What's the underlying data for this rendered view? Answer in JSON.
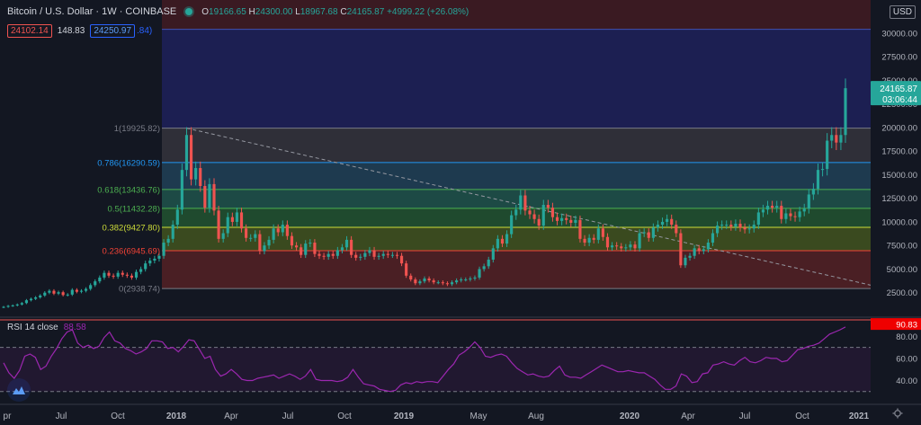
{
  "header": {
    "title": "Bitcoin / U.S. Dollar · 1W · COINBASE",
    "ohlc": {
      "o": "19166.65",
      "h": "24300.00",
      "l": "18967.68",
      "c": "24165.87",
      "chg": "+4999.22 (+26.08%)"
    }
  },
  "bid_ask": {
    "bid": "24102.14",
    "spread": "148.83",
    "ask": "24250.97",
    "ask_extra": ".84)"
  },
  "currency": "USD",
  "rsi": {
    "label": "RSI 14 close",
    "value": "88.58",
    "last_badge": "90.83",
    "y_ticks": [
      "80.00",
      "60.00",
      "40.00"
    ],
    "bands": [
      70,
      30
    ]
  },
  "price_axis": {
    "last_price": "24165.87",
    "countdown": "03:06:44"
  },
  "colors": {
    "up": "#26a69a",
    "down": "#ef5350",
    "rsi": "#9c27b0",
    "background": "#131722",
    "text": "#d1d4dc",
    "ask": "#2962ff"
  },
  "icons": {
    "logo": "tradingview-icon",
    "settings": "gear-icon"
  },
  "chart_data": {
    "type": "candlestick",
    "title": "Bitcoin / U.S. Dollar",
    "timeframe": "1W",
    "exchange": "COINBASE",
    "x_tick_labels": [
      "pr",
      "Jul",
      "Oct",
      "2018",
      "Apr",
      "Jul",
      "Oct",
      "2019",
      "May",
      "Aug",
      "2020",
      "Apr",
      "Jul",
      "Oct",
      "2021"
    ],
    "y_ticks": [
      "2500.00",
      "5000.00",
      "7500.00",
      "10000.00",
      "12500.00",
      "15000.00",
      "17500.00",
      "20000.00",
      "22500.00",
      "25000.00",
      "27500.00",
      "30000.00"
    ],
    "ylim": [
      0,
      33500
    ],
    "fib_levels": [
      {
        "label": "1(19925.82)",
        "value": 19925.82,
        "color": "#787b86"
      },
      {
        "label": "0.786(16290.59)",
        "value": 16290.59,
        "color": "#2196f3"
      },
      {
        "label": "0.618(13436.76)",
        "value": 13436.76,
        "color": "#4caf50"
      },
      {
        "label": "0.5(11432.28)",
        "value": 11432.28,
        "color": "#4caf50"
      },
      {
        "label": "0.382(9427.80)",
        "value": 9427.8,
        "color": "#cddc39"
      },
      {
        "label": "0.236(6945.69)",
        "value": 6945.69,
        "color": "#f44336"
      },
      {
        "label": "0(2938.74)",
        "value": 2938.74,
        "color": "#787b86"
      }
    ],
    "extension_top": 30400,
    "trend_line": {
      "from": {
        "date": "2017-12-18",
        "value": 19925.82
      },
      "to": {
        "date": "2021-01-11",
        "value": 3300
      }
    },
    "weekly_close": [
      1000,
      1100,
      1150,
      1250,
      1400,
      1700,
      1850,
      2000,
      2200,
      2500,
      2700,
      2400,
      2550,
      2250,
      2300,
      2800,
      2600,
      2700,
      2900,
      3300,
      3700,
      4100,
      4600,
      4300,
      4200,
      4600,
      4400,
      4300,
      4100,
      4700,
      5000,
      5600,
      5900,
      6100,
      6400,
      7800,
      8200,
      9700,
      11300,
      15500,
      19200,
      14500,
      15700,
      13800,
      11500,
      14000,
      11200,
      8200,
      8800,
      10500,
      10000,
      11000,
      9300,
      8300,
      8300,
      8700,
      6900,
      7500,
      8100,
      9300,
      8900,
      9700,
      8500,
      7500,
      7300,
      6500,
      7700,
      7800,
      6600,
      6400,
      6300,
      6600,
      6400,
      7000,
      7300,
      8100,
      6500,
      6200,
      6300,
      6700,
      7000,
      6300,
      6400,
      6600,
      6500,
      6500,
      6400,
      5600,
      4300,
      3900,
      3500,
      3700,
      4000,
      3800,
      3600,
      3600,
      3500,
      3400,
      3600,
      3800,
      3900,
      3900,
      4000,
      4100,
      5000,
      5300,
      6000,
      7200,
      8200,
      7700,
      8700,
      10700,
      11300,
      12800,
      11200,
      10800,
      10300,
      9600,
      11800,
      11500,
      10500,
      10100,
      10400,
      10200,
      9900,
      10200,
      8200,
      7800,
      8300,
      8100,
      9300,
      8400,
      7300,
      7500,
      7400,
      7200,
      7300,
      7600,
      7200,
      8800,
      8900,
      8300,
      9400,
      9700,
      10000,
      10300,
      9700,
      8800,
      5400,
      6200,
      6400,
      7200,
      6900,
      7100,
      7800,
      8800,
      9600,
      9700,
      9700,
      9500,
      9800,
      9400,
      9200,
      9300,
      9700,
      11000,
      11300,
      11700,
      11500,
      11700,
      10300,
      10900,
      10600,
      10500,
      11100,
      11400,
      12900,
      13500,
      15500,
      15600,
      18600,
      19200,
      18400,
      19200,
      24160
    ],
    "rsi_values": [
      56,
      47,
      42,
      49,
      62,
      64,
      61,
      50,
      53,
      62,
      69,
      78,
      84,
      86,
      74,
      70,
      72,
      69,
      71,
      79,
      84,
      76,
      74,
      69,
      67,
      64,
      66,
      69,
      76,
      76,
      75,
      69,
      70,
      66,
      71,
      77,
      76,
      68,
      60,
      62,
      50,
      44,
      46,
      50,
      46,
      41,
      40,
      40,
      42,
      43,
      44,
      45,
      42,
      44,
      46,
      44,
      41,
      44,
      50,
      41,
      40,
      40,
      40,
      39,
      40,
      43,
      50,
      43,
      37,
      36,
      35,
      32,
      31,
      30,
      31,
      36,
      38,
      37,
      39,
      38,
      39,
      39,
      38,
      44,
      50,
      55,
      63,
      66,
      70,
      75,
      70,
      62,
      61,
      63,
      64,
      62,
      56,
      51,
      48,
      45,
      46,
      44,
      43,
      44,
      49,
      53,
      45,
      43,
      43,
      42,
      45,
      48,
      51,
      54,
      52,
      50,
      48,
      48,
      49,
      48,
      47,
      47,
      44,
      41,
      36,
      32,
      32,
      35,
      46,
      44,
      38,
      39,
      46,
      47,
      54,
      55,
      57,
      55,
      54,
      58,
      61,
      57,
      56,
      58,
      61,
      60,
      60,
      57,
      58,
      63,
      68,
      69,
      71,
      72,
      74,
      78,
      82,
      84,
      86,
      88.58
    ]
  }
}
